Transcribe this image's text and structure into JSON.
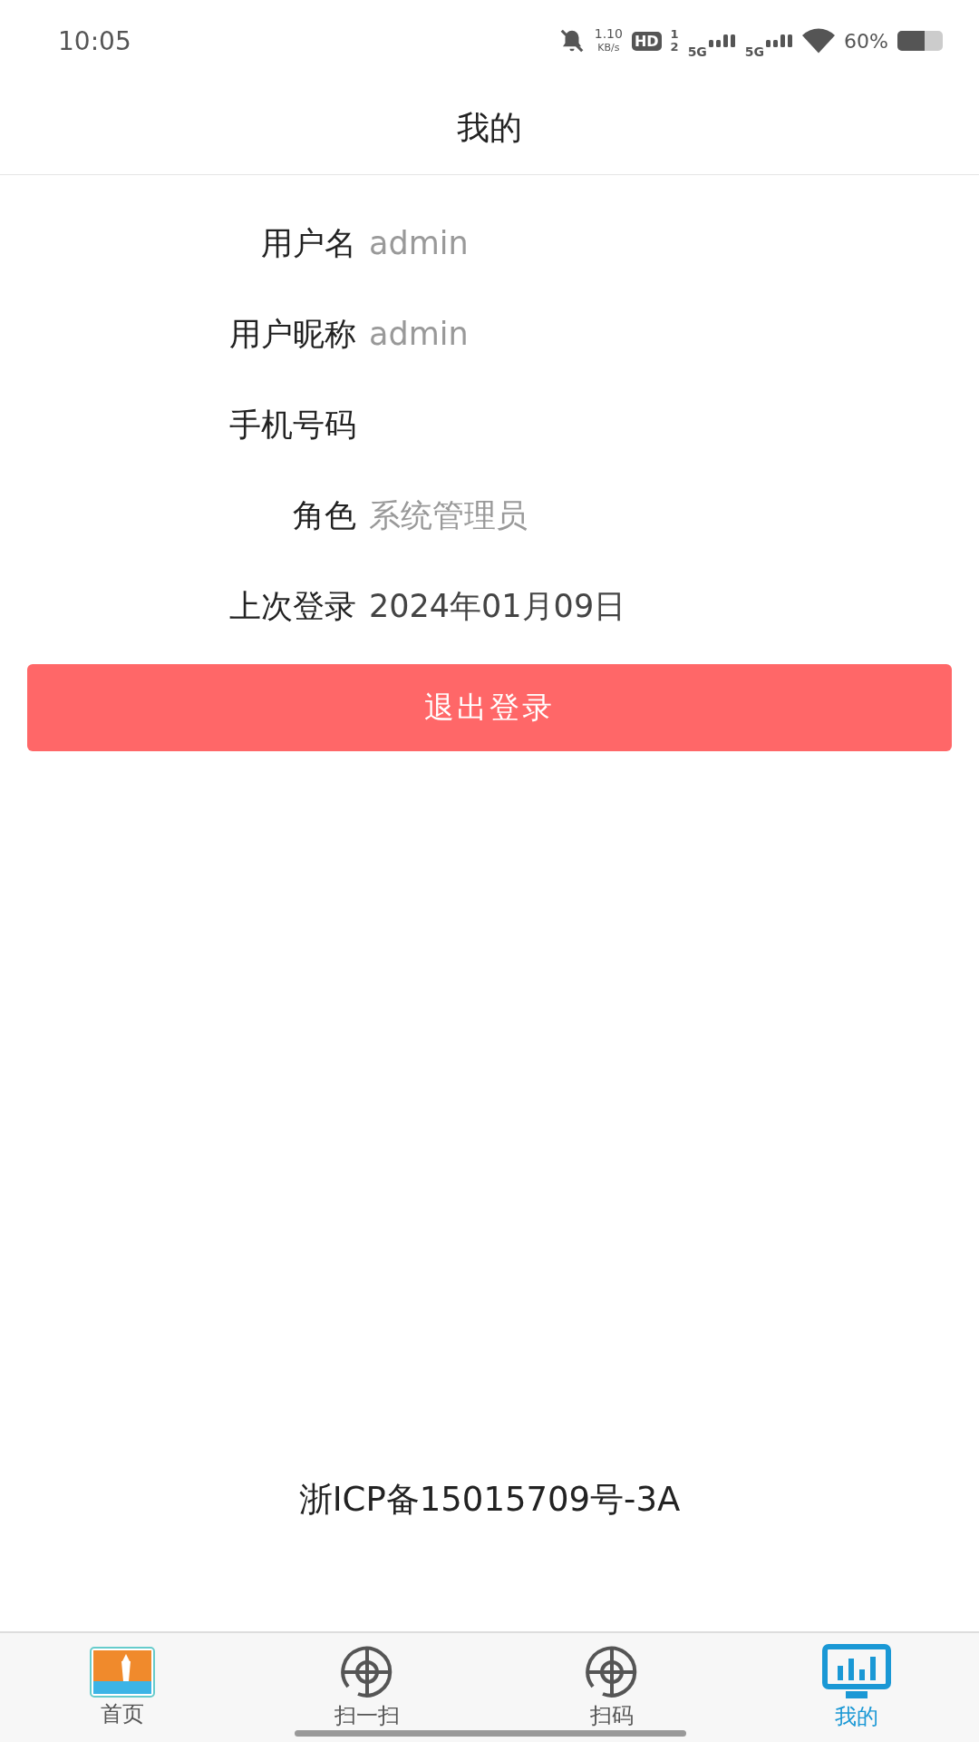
{
  "status_bar": {
    "time": "10:05",
    "speed": "1.10",
    "speed_unit": "KB/s",
    "hd": "HD",
    "sim_1": "1",
    "sim_2": "2",
    "network_1": "5G",
    "network_2": "5G",
    "battery": "60%"
  },
  "header": {
    "title": "我的"
  },
  "fields": [
    {
      "label": "用户名",
      "value": "admin"
    },
    {
      "label": "用户昵称",
      "value": "admin"
    },
    {
      "label": "手机号码"
    },
    {
      "label": "角色",
      "value": "系统管理员"
    },
    {
      "label": "上次登录",
      "value": "2024年01月09日",
      "kind": "dark"
    }
  ],
  "logout_button": "退出登录",
  "footer": "浙ICP备15015709号-3A",
  "tabs": [
    {
      "label": "首页",
      "kind": "logo",
      "selected": false
    },
    {
      "label": "扫一扫",
      "kind": "target",
      "selected": false
    },
    {
      "label": "扫码",
      "kind": "target",
      "selected": false
    },
    {
      "label": "我的",
      "kind": "chart",
      "selected": true
    }
  ]
}
